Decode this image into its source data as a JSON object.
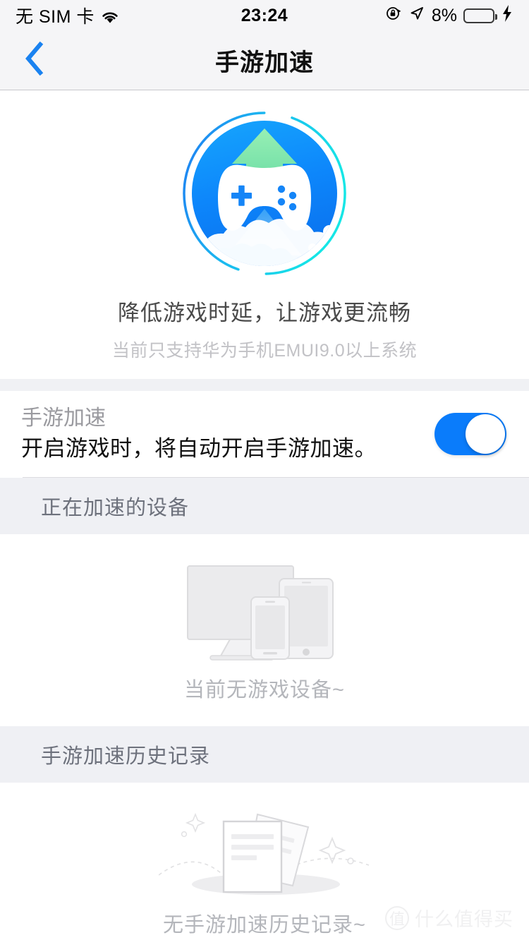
{
  "status_bar": {
    "carrier": "无 SIM 卡",
    "wifi_icon": "wifi-icon",
    "time": "23:24",
    "rotation_lock_icon": "rotation-lock-icon",
    "location_icon": "location-arrow-icon",
    "battery_percent": "8%",
    "battery_level": 8,
    "battery_icon": "battery-icon",
    "charging_icon": "lightning-bolt-icon"
  },
  "nav": {
    "back_icon": "chevron-left-icon",
    "title": "手游加速"
  },
  "hero": {
    "illustration": "game-boost-rocket-icon",
    "title": "降低游戏时延，让游戏更流畅",
    "subtitle": "当前只支持华为手机EMUI9.0以上系统"
  },
  "toggle_row": {
    "title": "手游加速",
    "subtitle": "开启游戏时，将自动开启手游加速。",
    "switch_on": true,
    "switch_color": "#0a7cfb"
  },
  "sections": [
    {
      "header": "正在加速的设备",
      "empty_illustration": "devices-monitor-tablet-phone-icon",
      "empty_label": "当前无游戏设备~"
    },
    {
      "header": "手游加速历史记录",
      "empty_illustration": "documents-papers-icon",
      "empty_label": "无手游加速历史记录~"
    }
  ],
  "watermark": {
    "badge": "值",
    "text": "什么值得买"
  },
  "colors": {
    "accent_blue": "#0a7cfb",
    "back_chevron": "#1a82f0",
    "band_gray": "#eff0f4",
    "battery_red": "#fa3d2e"
  }
}
